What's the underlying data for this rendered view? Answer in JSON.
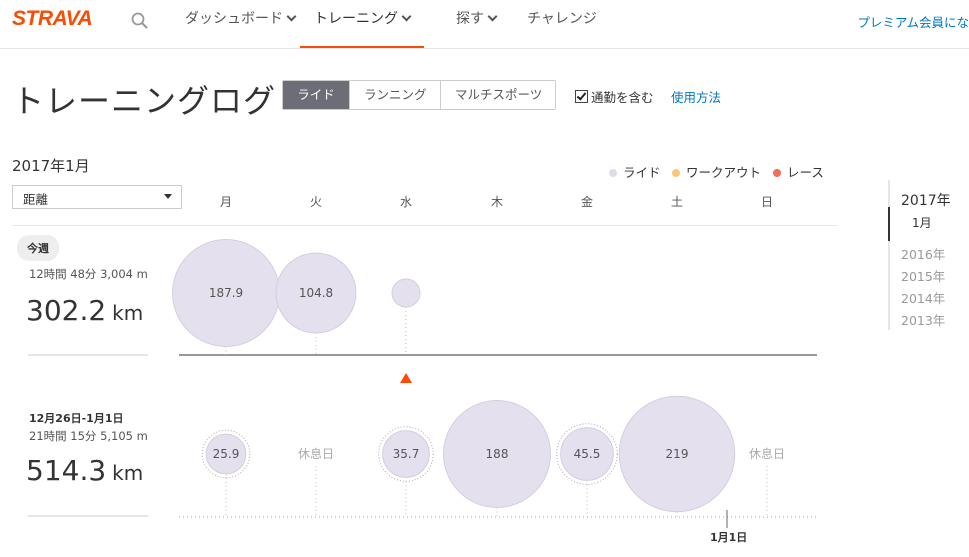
{
  "nav": {
    "logo": "STRAVA",
    "items": [
      {
        "label": "ダッシュボード",
        "has_chevron": true
      },
      {
        "label": "トレーニング",
        "has_chevron": true,
        "active": true
      },
      {
        "label": "探す",
        "has_chevron": true
      },
      {
        "label": "チャレンジ",
        "has_chevron": false
      }
    ],
    "premium_link": "プレミアム会員にな"
  },
  "header": {
    "title": "トレーニングログ",
    "sport_tabs": [
      {
        "label": "ライド",
        "active": true
      },
      {
        "label": "ランニング",
        "active": false
      },
      {
        "label": "マルチスポーツ",
        "active": false
      }
    ],
    "commute_checkbox": {
      "label": "通勤を含む",
      "checked": true
    },
    "help_link": "使用方法"
  },
  "controls": {
    "month_label": "2017年1月",
    "metric_select_value": "距離"
  },
  "legend": [
    {
      "label": "ライド",
      "color": "#e0dbe9"
    },
    {
      "label": "ワークアウト",
      "color": "#f9c87a"
    },
    {
      "label": "レース",
      "color": "#ef6f5c"
    }
  ],
  "weekdays": [
    "月",
    "火",
    "水",
    "木",
    "金",
    "土",
    "日"
  ],
  "weeks": [
    {
      "badge": "今週",
      "stats": "12時間 48分   3,004 m",
      "distance": "302.2",
      "unit": "km",
      "days": [
        {
          "label": "187.9",
          "value": 187.9
        },
        {
          "label": "104.8",
          "value": 104.8
        },
        {
          "label": "",
          "value": 6,
          "small": true
        },
        null,
        null,
        null,
        null
      ]
    },
    {
      "range": "12月26日-1月1日",
      "stats": "21時間 15分   5,105 m",
      "distance": "514.3",
      "unit": "km",
      "days": [
        {
          "label": "25.9",
          "value": 25.9,
          "dotted": true
        },
        {
          "rest": "休息日"
        },
        {
          "label": "35.7",
          "value": 35.7,
          "dotted": true
        },
        {
          "label": "188",
          "value": 188
        },
        {
          "label": "45.5",
          "value": 45.5,
          "dotted": true
        },
        {
          "label": "219",
          "value": 219
        },
        {
          "rest": "休息日"
        }
      ]
    }
  ],
  "date_marker": "1月1日",
  "year_sidebar": {
    "active_year": "2017年",
    "active_month": "1月",
    "past_years": [
      "2016年",
      "2015年",
      "2014年",
      "2013年"
    ]
  },
  "colors": {
    "brand": "#fc4c02",
    "bubble_fill": "#e5e0ee",
    "bubble_stroke": "#d4cde0",
    "link": "#0077c2"
  }
}
